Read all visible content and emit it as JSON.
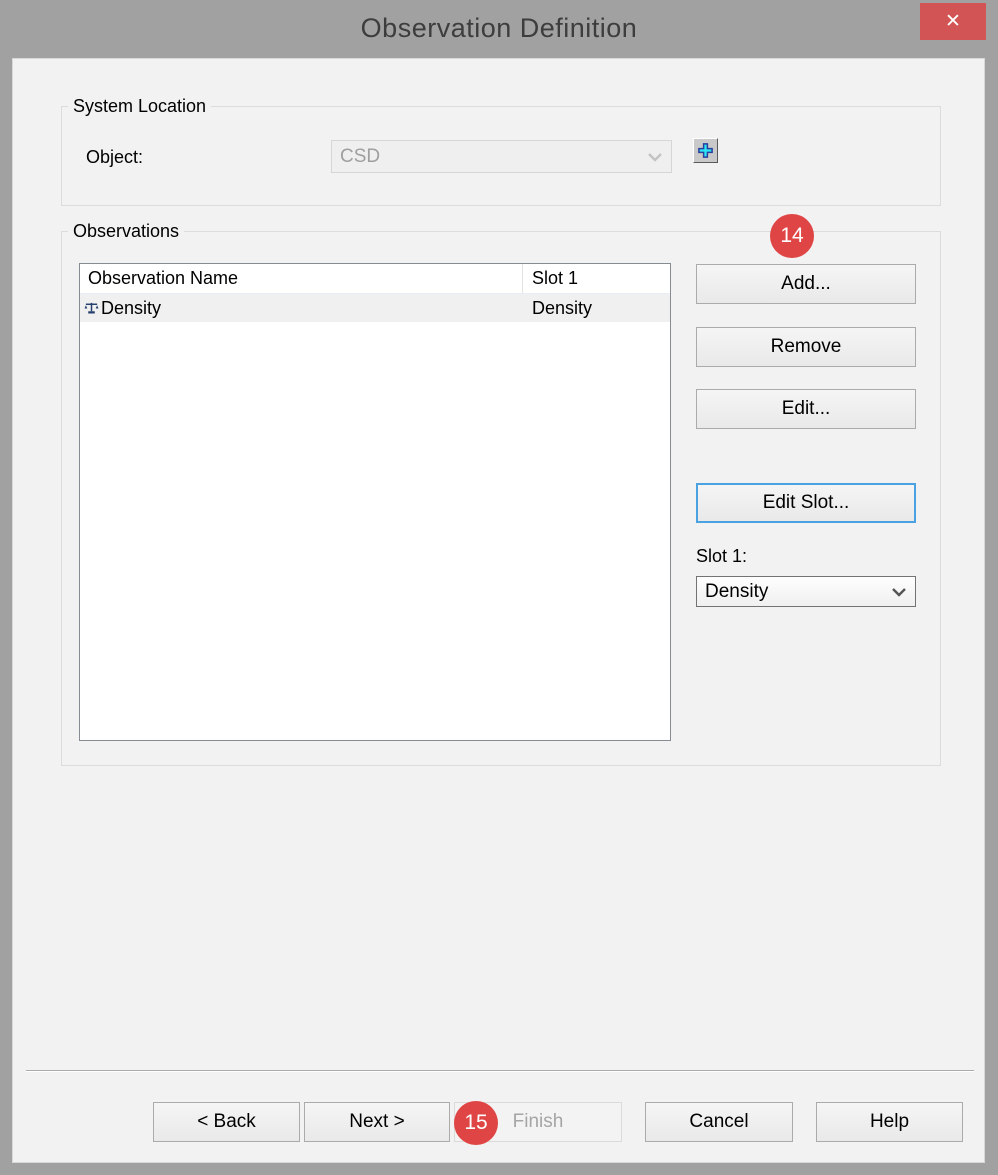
{
  "window": {
    "title": "Observation Definition",
    "close_glyph": "✕"
  },
  "colors": {
    "titlebar_bg": "#a1a1a1",
    "close_red": "#d25454",
    "badge_red": "#e04545",
    "focus_blue": "#4aa2e2",
    "body_bg": "#f2f2f2"
  },
  "system_location": {
    "legend": "System Location",
    "object_label": "Object:",
    "object_value": "CSD",
    "object_disabled": true
  },
  "observations": {
    "legend": "Observations",
    "table": {
      "columns": [
        "Observation Name",
        "Slot 1"
      ],
      "rows": [
        {
          "icon": "balance-icon",
          "name": "Density",
          "slot1": "Density"
        }
      ]
    },
    "buttons": {
      "add": "Add...",
      "remove": "Remove",
      "edit": "Edit...",
      "edit_slot": "Edit Slot..."
    },
    "slot_label": "Slot 1:",
    "slot_value": "Density"
  },
  "badges": {
    "step_add": "14",
    "step_finish": "15"
  },
  "footer": {
    "back": "< Back",
    "next": "Next >",
    "finish": "Finish",
    "cancel": "Cancel",
    "help": "Help"
  },
  "icons": {
    "close": "close-icon",
    "add_object": "plus-icon",
    "row": "balance-icon",
    "dropdown": "chevron-down-icon"
  }
}
